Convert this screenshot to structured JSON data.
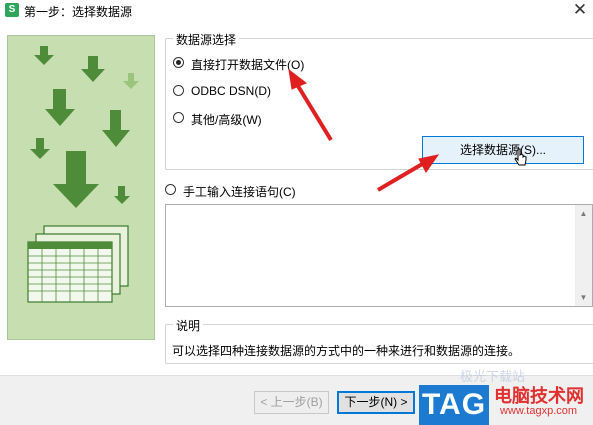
{
  "window": {
    "app_icon": "S",
    "title": "第一步：选择数据源",
    "close_glyph": "✕"
  },
  "datasource_group": {
    "label": "数据源选择",
    "options": [
      {
        "label": "直接打开数据文件(O)",
        "checked": true
      },
      {
        "label": "ODBC DSN(D)",
        "checked": false
      },
      {
        "label": "其他/高级(W)",
        "checked": false
      }
    ],
    "select_button": "选择数据源(S)..."
  },
  "manual": {
    "label": "手工输入连接语句(C)",
    "checked": false,
    "value": ""
  },
  "description": {
    "label": "说明",
    "text": "可以选择四种连接数据源的方式中的一种来进行和数据源的连接。"
  },
  "footer": {
    "prev_button": "< 上一步(B)",
    "next_button": "下一步(N) >"
  },
  "watermark": {
    "tag": "TAG",
    "site_name": "电脑技术网",
    "url": "www.tagxp.com",
    "faint_text": "极光下载站"
  },
  "colors": {
    "panel_bg": "#c7dfb0",
    "arrow_green": "#4f8c3a",
    "arrow_light": "#9bc47d",
    "annotation_red": "#e02020",
    "tag_blue": "#1d7ad1"
  }
}
